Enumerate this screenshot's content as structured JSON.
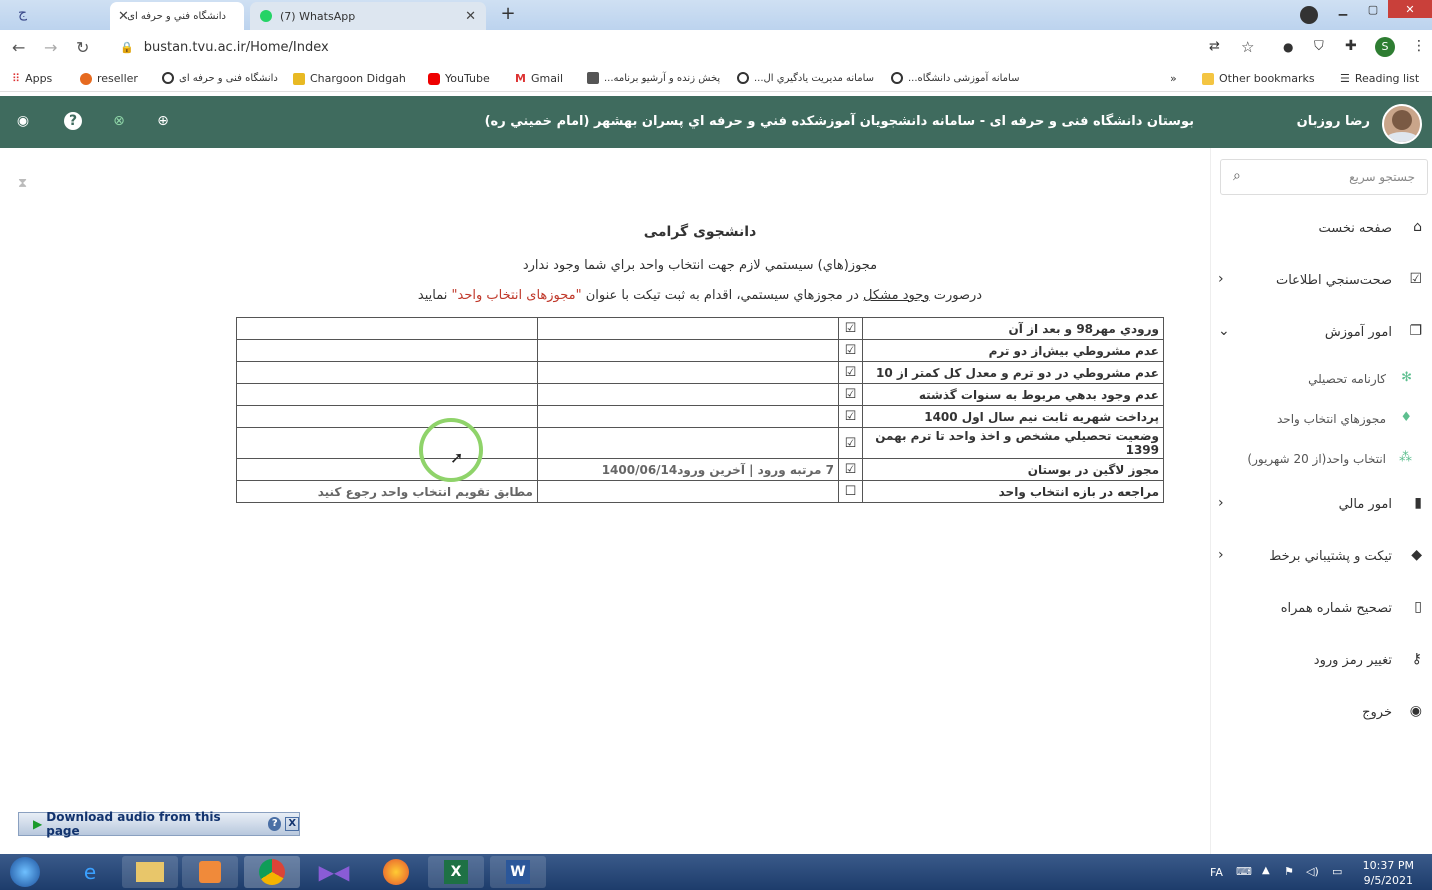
{
  "browser": {
    "tabs": [
      {
        "label": "دانشگاه فني و حرفه اى",
        "active": true
      },
      {
        "label": "(7) WhatsApp",
        "active": false
      }
    ],
    "url": "bustan.tvu.ac.ir/Home/Index",
    "profile_initial": "S",
    "bookmarks": [
      {
        "label": "Apps",
        "icon": "apps-grid-icon"
      },
      {
        "label": "reseller",
        "icon": "fruit-icon"
      },
      {
        "label": "دانشگاه فنی و حرفه ای",
        "icon": "globe-icon"
      },
      {
        "label": "Chargoon Didgah",
        "icon": "chargoon-icon"
      },
      {
        "label": "YouTube",
        "icon": "youtube-icon"
      },
      {
        "label": "Gmail",
        "icon": "gmail-icon"
      },
      {
        "label": "پخش زنده و آرشیو برنامه...",
        "icon": "tv-icon"
      },
      {
        "label": "سامانه مديريت يادگيري ال...",
        "icon": "globe-icon"
      },
      {
        "label": "سامانه آموزشی دانشگاه...",
        "icon": "globe-icon"
      }
    ],
    "bookmarks_overflow": "»",
    "other_bookmarks": "Other bookmarks",
    "reading_list": "Reading list"
  },
  "site_header": {
    "title": "بوستان دانشگاه فنی و حرفه ای - سامانه دانشجويان آموزشکده فني و حرفه اي پسران بهشهر (امام خميني ره)",
    "user_name": "رضا روزبان"
  },
  "sidebar": {
    "search_placeholder": "جستجو سريع",
    "items": [
      {
        "label": "صفحه نخست",
        "icon": "home-icon",
        "has_children": false
      },
      {
        "label": "صحت‌سنجي اطلاعات",
        "icon": "checkbox-icon",
        "has_children": true
      },
      {
        "label": "امور آموزش",
        "icon": "copy-icon",
        "has_children": true,
        "expanded": true
      },
      {
        "label": "امور مالي",
        "icon": "file-icon",
        "has_children": true
      },
      {
        "label": "تيکت و پشتيباني برخط",
        "icon": "tags-icon",
        "has_children": true
      },
      {
        "label": "تصحيح شماره همراه",
        "icon": "mobile-icon",
        "has_children": false
      },
      {
        "label": "تغيير رمز ورود",
        "icon": "key-icon",
        "has_children": false
      },
      {
        "label": "خروج",
        "icon": "toggle-icon",
        "has_children": false
      }
    ],
    "sub_items": [
      {
        "label": "کارنامه تحصيلي",
        "icon": "asterisk-icon"
      },
      {
        "label": "مجوزهاي انتخاب واحد",
        "icon": "bell-icon"
      },
      {
        "label": "انتخاب واحد(از 20 شهريور)",
        "icon": "cubes-icon"
      }
    ]
  },
  "main": {
    "greeting": "دانشجوی گرامی",
    "message": "مجوز(هاي) سيستمي لازم جهت انتخاب واحد براي شما وجود ندارد",
    "instruction_prefix": "درصورت",
    "instruction_underlined": "وجود مشکل",
    "instruction_middle": "در مجوزهاي سيستمي، اقدام به ثبت تيکت با عنوان",
    "instruction_highlight": "\"مجوزهای انتخاب واحد\"",
    "instruction_suffix": "نماييد",
    "table": [
      {
        "label": "ورودي مهر98 و بعد از آن",
        "checked": "☑",
        "info": "",
        "extra": ""
      },
      {
        "label": "عدم مشروطي بيش‌از دو ترم",
        "checked": "☑",
        "info": "",
        "extra": ""
      },
      {
        "label": "عدم مشروطي در دو ترم و معدل کل کمتر از 10",
        "checked": "☑",
        "info": "",
        "extra": ""
      },
      {
        "label": "عدم وجود بدهي مربوط به سنوات گذشته",
        "checked": "☑",
        "info": "",
        "extra": ""
      },
      {
        "label": "پرداخت شهريه ثابت نيم سال اول 1400",
        "checked": "☑",
        "info": "",
        "extra": ""
      },
      {
        "label": "وضعيت تحصيلي مشخص و اخذ واحد تا ترم بهمن 1399",
        "checked": "☑",
        "info": "",
        "extra": ""
      },
      {
        "label": "مجوز لاگين در بوستان",
        "checked": "☑",
        "info": "7 مرتبه ورود | آخرين ورود1400/06/14",
        "extra": ""
      },
      {
        "label": "مراجعه در بازه انتخاب واحد",
        "checked": "☐",
        "info": "",
        "extra": "مطابق تقويم انتخاب واحد رجوع کنيد"
      }
    ]
  },
  "download_bar": {
    "label": "Download audio from this page",
    "help": "?",
    "close": "X"
  },
  "taskbar": {
    "lang": "FA",
    "time": "10:37 PM",
    "date": "9/5/2021"
  },
  "colors": {
    "header_bg": "#3f6b5e",
    "highlight_red": "#c0392b",
    "submenu_icon": "#5dbf8f"
  }
}
